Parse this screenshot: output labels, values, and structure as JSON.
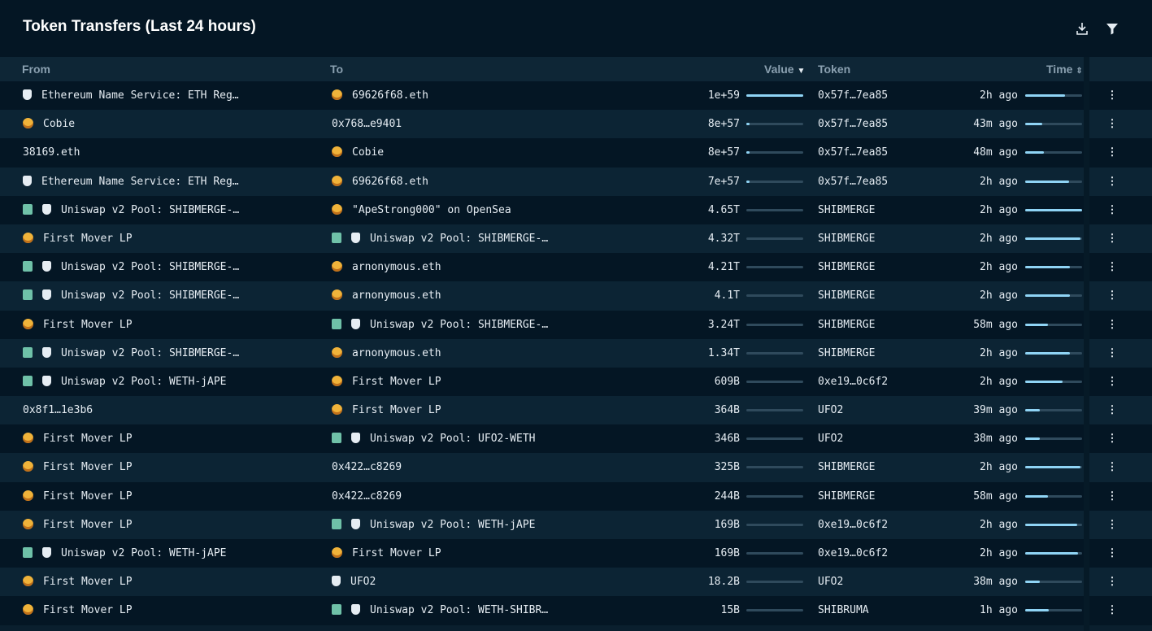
{
  "title": "Token Transfers (Last 24 hours)",
  "icons": {
    "download": "download-icon",
    "filter": "filter-icon"
  },
  "columns": {
    "from": "From",
    "to": "To",
    "value": "Value",
    "token": "Token",
    "time": "Time"
  },
  "rows": [
    {
      "from_icons": [
        "shield"
      ],
      "from": "Ethereum Name Service: ETH Reg…",
      "to_icons": [
        "face"
      ],
      "to": "69626f68.eth",
      "value": "1e+59",
      "value_level": 1.0,
      "token": "0x57f…7ea85",
      "time": "2h ago",
      "time_level": 0.7
    },
    {
      "from_icons": [
        "face"
      ],
      "from": "Cobie",
      "to_icons": [],
      "to": "0x768…e9401",
      "value": "8e+57",
      "value_level": 0.06,
      "token": "0x57f…7ea85",
      "time": "43m ago",
      "time_level": 0.3
    },
    {
      "from_icons": [],
      "from": "38169.eth",
      "to_icons": [
        "face"
      ],
      "to": "Cobie",
      "value": "8e+57",
      "value_level": 0.06,
      "token": "0x57f…7ea85",
      "time": "48m ago",
      "time_level": 0.33
    },
    {
      "from_icons": [
        "shield"
      ],
      "from": "Ethereum Name Service: ETH Reg…",
      "to_icons": [
        "face"
      ],
      "to": "69626f68.eth",
      "value": "7e+57",
      "value_level": 0.06,
      "token": "0x57f…7ea85",
      "time": "2h ago",
      "time_level": 0.77
    },
    {
      "from_icons": [
        "contract",
        "shield"
      ],
      "from": "Uniswap v2 Pool: SHIBMERGE-…",
      "to_icons": [
        "face"
      ],
      "to": "\"ApeStrong000\" on OpenSea",
      "value": "4.65T",
      "value_level": 0.0,
      "token": "SHIBMERGE",
      "time": "2h ago",
      "time_level": 1.0
    },
    {
      "from_icons": [
        "face"
      ],
      "from": "First Mover LP",
      "to_icons": [
        "contract",
        "shield"
      ],
      "to": "Uniswap v2 Pool: SHIBMERGE-…",
      "value": "4.32T",
      "value_level": 0.0,
      "token": "SHIBMERGE",
      "time": "2h ago",
      "time_level": 0.97
    },
    {
      "from_icons": [
        "contract",
        "shield"
      ],
      "from": "Uniswap v2 Pool: SHIBMERGE-…",
      "to_icons": [
        "face"
      ],
      "to": "arnonymous.eth",
      "value": "4.21T",
      "value_level": 0.0,
      "token": "SHIBMERGE",
      "time": "2h ago",
      "time_level": 0.79
    },
    {
      "from_icons": [
        "contract",
        "shield"
      ],
      "from": "Uniswap v2 Pool: SHIBMERGE-…",
      "to_icons": [
        "face"
      ],
      "to": "arnonymous.eth",
      "value": "4.1T",
      "value_level": 0.0,
      "token": "SHIBMERGE",
      "time": "2h ago",
      "time_level": 0.79
    },
    {
      "from_icons": [
        "face"
      ],
      "from": "First Mover LP",
      "to_icons": [
        "contract",
        "shield"
      ],
      "to": "Uniswap v2 Pool: SHIBMERGE-…",
      "value": "3.24T",
      "value_level": 0.0,
      "token": "SHIBMERGE",
      "time": "58m ago",
      "time_level": 0.4
    },
    {
      "from_icons": [
        "contract",
        "shield"
      ],
      "from": "Uniswap v2 Pool: SHIBMERGE-…",
      "to_icons": [
        "face"
      ],
      "to": "arnonymous.eth",
      "value": "1.34T",
      "value_level": 0.0,
      "token": "SHIBMERGE",
      "time": "2h ago",
      "time_level": 0.79
    },
    {
      "from_icons": [
        "contract",
        "shield"
      ],
      "from": "Uniswap v2 Pool: WETH-jAPE",
      "to_icons": [
        "face"
      ],
      "to": "First Mover LP",
      "value": "609B",
      "value_level": 0.0,
      "token": "0xe19…0c6f2",
      "time": "2h ago",
      "time_level": 0.66
    },
    {
      "from_icons": [],
      "from": "0x8f1…1e3b6",
      "to_icons": [
        "face"
      ],
      "to": "First Mover LP",
      "value": "364B",
      "value_level": 0.0,
      "token": "UFO2",
      "time": "39m ago",
      "time_level": 0.26
    },
    {
      "from_icons": [
        "face"
      ],
      "from": "First Mover LP",
      "to_icons": [
        "contract",
        "shield"
      ],
      "to": "Uniswap v2 Pool: UFO2-WETH",
      "value": "346B",
      "value_level": 0.0,
      "token": "UFO2",
      "time": "38m ago",
      "time_level": 0.25
    },
    {
      "from_icons": [
        "face"
      ],
      "from": "First Mover LP",
      "to_icons": [],
      "to": "0x422…c8269",
      "value": "325B",
      "value_level": 0.0,
      "token": "SHIBMERGE",
      "time": "2h ago",
      "time_level": 0.97
    },
    {
      "from_icons": [
        "face"
      ],
      "from": "First Mover LP",
      "to_icons": [],
      "to": "0x422…c8269",
      "value": "244B",
      "value_level": 0.0,
      "token": "SHIBMERGE",
      "time": "58m ago",
      "time_level": 0.4
    },
    {
      "from_icons": [
        "face"
      ],
      "from": "First Mover LP",
      "to_icons": [
        "contract",
        "shield"
      ],
      "to": "Uniswap v2 Pool: WETH-jAPE",
      "value": "169B",
      "value_level": 0.0,
      "token": "0xe19…0c6f2",
      "time": "2h ago",
      "time_level": 0.91
    },
    {
      "from_icons": [
        "contract",
        "shield"
      ],
      "from": "Uniswap v2 Pool: WETH-jAPE",
      "to_icons": [
        "face"
      ],
      "to": "First Mover LP",
      "value": "169B",
      "value_level": 0.0,
      "token": "0xe19…0c6f2",
      "time": "2h ago",
      "time_level": 0.93
    },
    {
      "from_icons": [
        "face"
      ],
      "from": "First Mover LP",
      "to_icons": [
        "shield"
      ],
      "to": "UFO2",
      "value": "18.2B",
      "value_level": 0.0,
      "token": "UFO2",
      "time": "38m ago",
      "time_level": 0.25
    },
    {
      "from_icons": [
        "face"
      ],
      "from": "First Mover LP",
      "to_icons": [
        "contract",
        "shield"
      ],
      "to": "Uniswap v2 Pool: WETH-SHIBR…",
      "value": "15B",
      "value_level": 0.0,
      "token": "SHIBRUMA",
      "time": "1h ago",
      "time_level": 0.42
    }
  ],
  "colors": {
    "accent": "#8fd4f5",
    "background": "#0a1f2e",
    "header_bg": "#041624"
  }
}
